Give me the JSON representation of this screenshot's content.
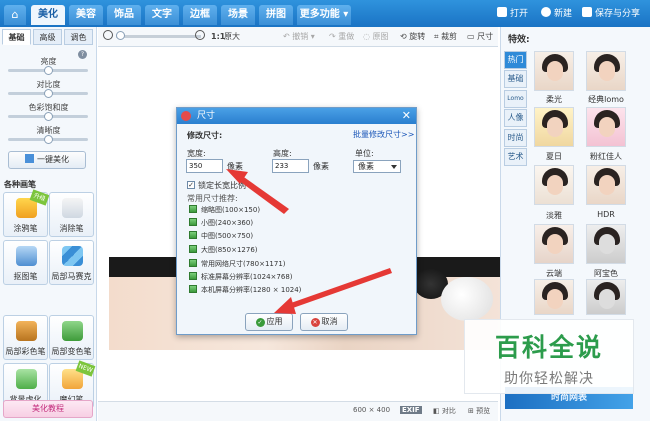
{
  "topbar": {
    "tabs": [
      {
        "label": "美化",
        "active": true
      },
      {
        "label": "美容",
        "active": false
      },
      {
        "label": "饰品",
        "active": false
      },
      {
        "label": "文字",
        "active": false
      },
      {
        "label": "边框",
        "active": false
      },
      {
        "label": "场景",
        "active": false
      },
      {
        "label": "拼图",
        "active": false
      },
      {
        "label": "更多功能",
        "active": false
      }
    ],
    "open": "打开",
    "new": "新建",
    "save_share": "保存与分享"
  },
  "left": {
    "subtabs": [
      "基础",
      "高级",
      "调色"
    ],
    "sliders": [
      {
        "label": "亮度",
        "value": 0.5
      },
      {
        "label": "对比度",
        "value": 0.5
      },
      {
        "label": "色彩饱和度",
        "value": 0.5
      },
      {
        "label": "清晰度",
        "value": 0.5
      }
    ],
    "one_click": "一键美化",
    "section_title": "各种画笔",
    "tools": [
      {
        "label": "涂鸦笔",
        "badge": "升级"
      },
      {
        "label": "消除笔"
      },
      {
        "label": "抠图笔"
      },
      {
        "label": "局部马赛克"
      },
      {
        "label": "局部彩色笔"
      },
      {
        "label": "局部变色笔"
      },
      {
        "label": "背景虚化"
      },
      {
        "label": "魔幻笔",
        "badge": "NEW"
      }
    ],
    "tutorial": "美化教程"
  },
  "toolbar": {
    "ratio": "1:1",
    "original": "原大",
    "undo": "撤销",
    "redo": "重做",
    "restore": "原图",
    "rotate": "旋转",
    "crop": "裁剪",
    "size": "尺寸"
  },
  "status": {
    "dimensions": "600 × 400",
    "exif": "EXIF",
    "compare": "对比",
    "preview": "预览"
  },
  "right": {
    "title": "特效:",
    "tabs": [
      "热门",
      "基础",
      "Lomo",
      "人像",
      "时尚",
      "艺术"
    ],
    "effects": [
      "柔光",
      "经典lomo",
      "夏日",
      "粉红佳人",
      "淡雅",
      "HDR",
      "云端",
      "阿宝色"
    ],
    "banner": "时尚网表"
  },
  "dialog": {
    "title": "尺寸",
    "heading": "修改尺寸:",
    "batch_link": "批量修改尺寸>>",
    "width_label": "宽度:",
    "width_value": "350",
    "width_unit": "像素",
    "height_label": "高度:",
    "height_value": "233",
    "height_unit": "像素",
    "unit_label": "单位:",
    "unit_value": "像素",
    "lock_label": "锁定长宽比例",
    "lock_checked": "✓",
    "presets_title": "常用尺寸推荐:",
    "presets": [
      "缩略图(100×150)",
      "小图(240×360)",
      "中图(500×750)",
      "大图(850×1276)",
      "常用网络尺寸(780×1171)",
      "标准屏幕分辨率(1024×768)",
      "本机屏幕分辨率(1280 × 1024)"
    ],
    "apply": "应用",
    "cancel": "取消"
  },
  "watermark": {
    "title": "百科全说",
    "subtitle": "助你轻松解决"
  },
  "colors": {
    "accent": "#2a7fcf",
    "arrow": "#e53935",
    "watermark": "#2c9c4c"
  }
}
